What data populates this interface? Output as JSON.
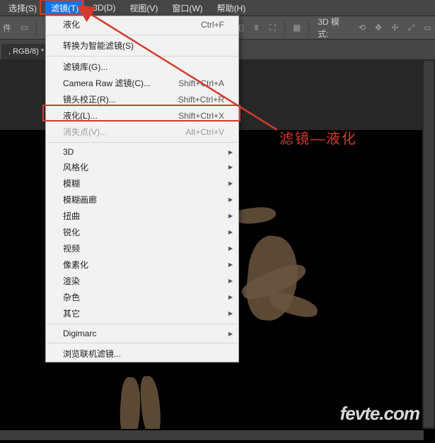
{
  "menubar": {
    "items": [
      {
        "label": "选择(S)"
      },
      {
        "label": "滤镜(T)"
      },
      {
        "label": "3D(D)"
      },
      {
        "label": "视图(V)"
      },
      {
        "label": "窗口(W)"
      },
      {
        "label": "帮助(H)"
      }
    ],
    "active_index": 1
  },
  "toolbar": {
    "left_text": "件",
    "mode_label": "3D 模式:"
  },
  "tab": {
    "label": ", RGB/8) *"
  },
  "dropdown": {
    "groups": [
      [
        {
          "label": "液化",
          "shortcut": "Ctrl+F"
        }
      ],
      [
        {
          "label": "转换为智能滤镜(S)"
        }
      ],
      [
        {
          "label": "滤镜库(G)..."
        },
        {
          "label": "Camera Raw 滤镜(C)...",
          "shortcut": "Shift+Ctrl+A"
        },
        {
          "label": "镜头校正(R)...",
          "shortcut": "Shift+Ctrl+R"
        },
        {
          "label": "液化(L)...",
          "shortcut": "Shift+Ctrl+X",
          "highlighted": true
        },
        {
          "label": "消失点(V)...",
          "shortcut": "Alt+Ctrl+V",
          "disabled": true
        }
      ],
      [
        {
          "label": "3D",
          "submenu": true
        },
        {
          "label": "风格化",
          "submenu": true
        },
        {
          "label": "模糊",
          "submenu": true
        },
        {
          "label": "模糊画廊",
          "submenu": true
        },
        {
          "label": "扭曲",
          "submenu": true
        },
        {
          "label": "锐化",
          "submenu": true
        },
        {
          "label": "视频",
          "submenu": true
        },
        {
          "label": "像素化",
          "submenu": true
        },
        {
          "label": "渲染",
          "submenu": true
        },
        {
          "label": "杂色",
          "submenu": true
        },
        {
          "label": "其它",
          "submenu": true
        }
      ],
      [
        {
          "label": "Digimarc",
          "submenu": true
        }
      ],
      [
        {
          "label": "浏览联机滤镜..."
        }
      ]
    ]
  },
  "annotation": {
    "text": "滤镜—液化"
  },
  "watermark": {
    "text": "fevte.com"
  }
}
